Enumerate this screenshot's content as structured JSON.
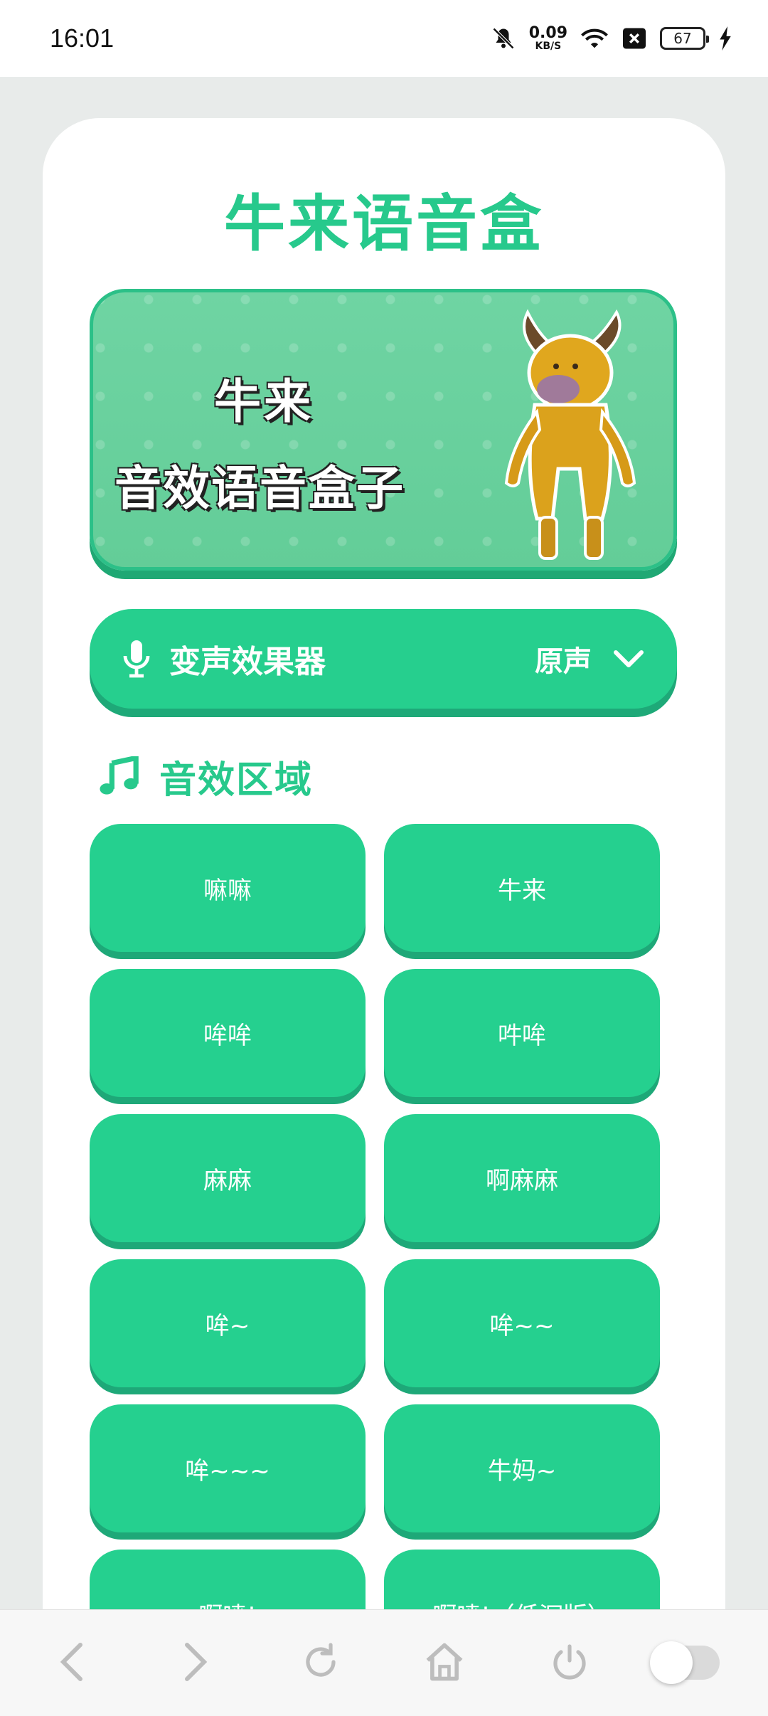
{
  "status_bar": {
    "time": "16:01",
    "net_speed_value": "0.09",
    "net_speed_unit": "KB/S",
    "battery": "67"
  },
  "app": {
    "title": "牛来语音盒"
  },
  "banner": {
    "line1": "牛来",
    "line2": "音效语音盒子"
  },
  "voice_changer": {
    "label": "变声效果器",
    "selected": "原声"
  },
  "sound_section": {
    "title": "音效区域",
    "buttons": [
      "嘛嘛",
      "牛来",
      "哞哞",
      "吽哞",
      "麻麻",
      "啊麻麻",
      "哞~",
      "哞~~",
      "哞~~~",
      "牛妈~",
      "啊喷!",
      "啊喷!（低沉版）"
    ]
  },
  "colors": {
    "accent": "#27c98c",
    "button": "#25d08f",
    "button_shadow": "#1ea878"
  },
  "bottom_nav": {
    "icons": [
      "back-icon",
      "forward-icon",
      "refresh-icon",
      "home-icon",
      "power-icon",
      "toggle"
    ]
  }
}
